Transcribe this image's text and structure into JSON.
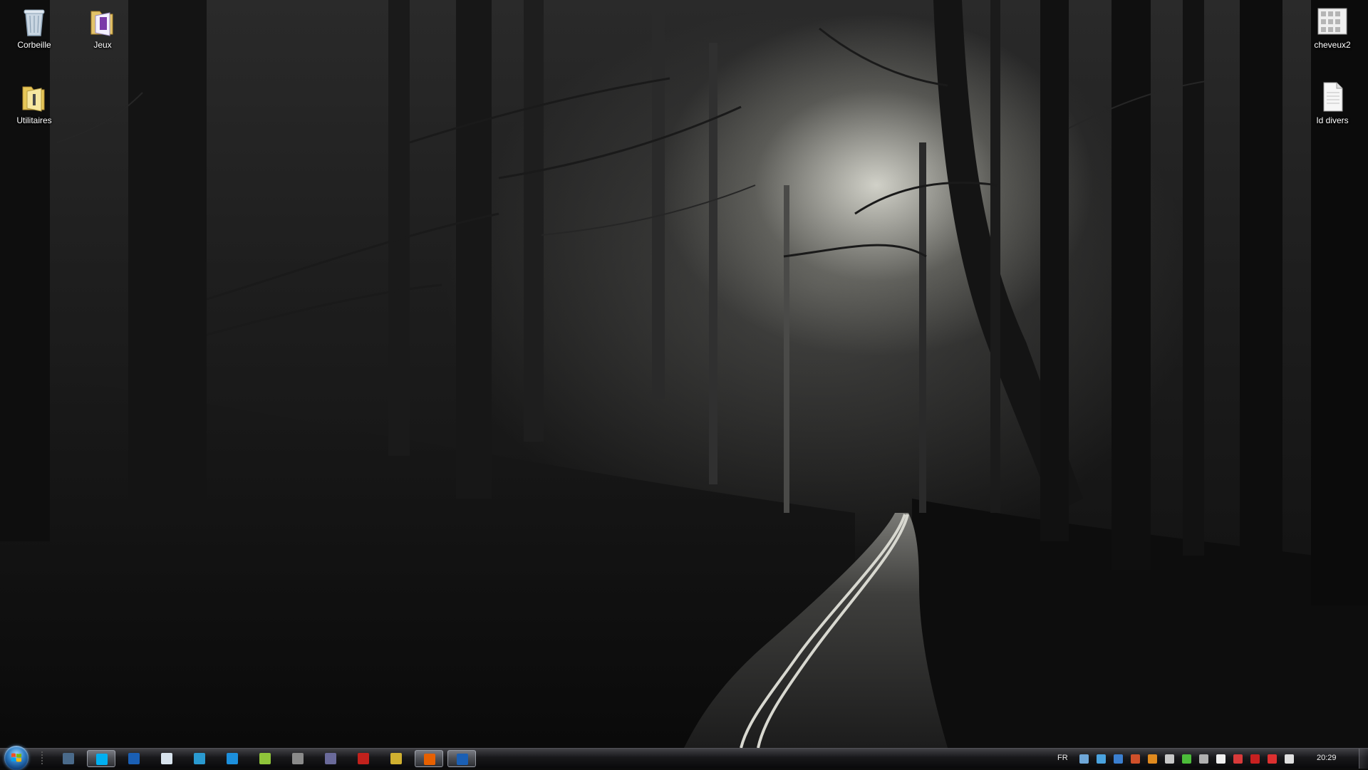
{
  "desktop": {
    "icons": [
      {
        "label": "Corbeille",
        "icon": "recycle-bin-icon"
      },
      {
        "label": "Jeux",
        "icon": "folder-icon"
      },
      {
        "label": "Utilitaires",
        "icon": "folder-icon"
      },
      {
        "label": "cheveux2",
        "icon": "image-file-icon"
      },
      {
        "label": "Id divers",
        "icon": "document-icon"
      }
    ]
  },
  "taskbar": {
    "start_icon": "windows-start-orb",
    "pinned": [
      {
        "icon": "media-center-icon",
        "color": "#4a6a8a"
      },
      {
        "icon": "skype-icon",
        "color": "#00aff0",
        "active": true
      },
      {
        "icon": "app-l-icon",
        "color": "#1a5fb4"
      },
      {
        "icon": "window-app-icon",
        "color": "#d9e4ee"
      },
      {
        "icon": "bluetooth-app-icon",
        "color": "#2a9ad0"
      },
      {
        "icon": "photoshop-icon",
        "color": "#1c8fdc"
      },
      {
        "icon": "app-green-drop-icon",
        "color": "#8fc43a"
      },
      {
        "icon": "calculator-icon",
        "color": "#8a8a8a"
      },
      {
        "icon": "movie-maker-icon",
        "color": "#6a6a9a"
      },
      {
        "icon": "app-red-icon",
        "color": "#c2211c"
      },
      {
        "icon": "app-tools-icon",
        "color": "#d0b030"
      },
      {
        "icon": "firefox-icon",
        "color": "#e66000",
        "active": true
      },
      {
        "icon": "app-l-active-icon",
        "color": "#1a5fb4",
        "active": true
      }
    ],
    "tray": {
      "language": "FR",
      "icons": [
        {
          "icon": "tray-network-icon",
          "color": "#6fa7d8"
        },
        {
          "icon": "tray-dropbox-icon",
          "color": "#4aa3df"
        },
        {
          "icon": "tray-bird-icon",
          "color": "#3b7fd0"
        },
        {
          "icon": "tray-speaker-red-icon",
          "color": "#d0502a"
        },
        {
          "icon": "tray-orange-icon",
          "color": "#e08a1e"
        },
        {
          "icon": "tray-steam-icon",
          "color": "#c8c8c8"
        },
        {
          "icon": "tray-green-icon",
          "color": "#4cbc3a"
        },
        {
          "icon": "tray-gear-icon",
          "color": "#b0b0b0"
        },
        {
          "icon": "tray-flag-icon",
          "color": "#f0f0f0"
        },
        {
          "icon": "tray-volume-icon",
          "color": "#d83a3a"
        },
        {
          "icon": "tray-red-icon",
          "color": "#c82020"
        },
        {
          "icon": "tray-action-center-icon",
          "color": "#dd3030"
        },
        {
          "icon": "tray-signal-icon",
          "color": "#e0e0e0"
        }
      ]
    },
    "clock": "20:29"
  }
}
